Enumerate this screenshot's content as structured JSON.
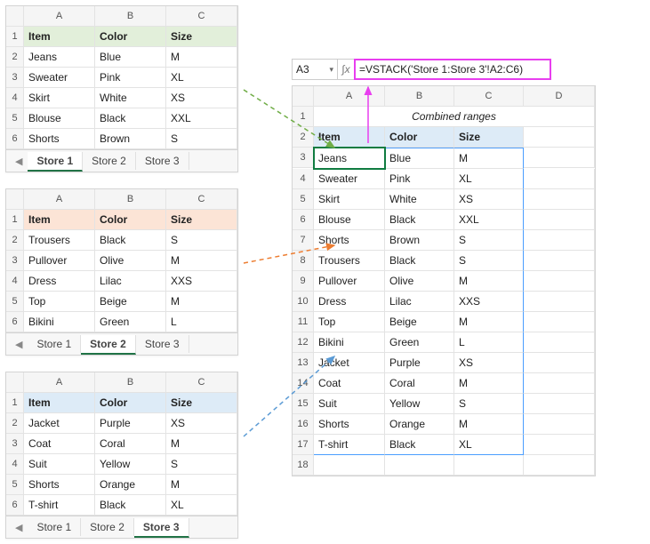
{
  "columns": [
    "A",
    "B",
    "C"
  ],
  "header_labels": {
    "item": "Item",
    "color": "Color",
    "size": "Size"
  },
  "store1": {
    "tab": "Store 1",
    "rows": [
      {
        "item": "Jeans",
        "color": "Blue",
        "size": "M"
      },
      {
        "item": "Sweater",
        "color": "Pink",
        "size": "XL"
      },
      {
        "item": "Skirt",
        "color": "White",
        "size": "XS"
      },
      {
        "item": "Blouse",
        "color": "Black",
        "size": "XXL"
      },
      {
        "item": "Shorts",
        "color": "Brown",
        "size": "S"
      }
    ]
  },
  "store2": {
    "tab": "Store 2",
    "rows": [
      {
        "item": "Trousers",
        "color": "Black",
        "size": "S"
      },
      {
        "item": "Pullover",
        "color": "Olive",
        "size": "M"
      },
      {
        "item": "Dress",
        "color": "Lilac",
        "size": "XXS"
      },
      {
        "item": "Top",
        "color": "Beige",
        "size": "M"
      },
      {
        "item": "Bikini",
        "color": "Green",
        "size": "L"
      }
    ]
  },
  "store3": {
    "tab": "Store 3",
    "rows": [
      {
        "item": "Jacket",
        "color": "Purple",
        "size": "XS"
      },
      {
        "item": "Coat",
        "color": "Coral",
        "size": "M"
      },
      {
        "item": "Suit",
        "color": "Yellow",
        "size": "S"
      },
      {
        "item": "Shorts",
        "color": "Orange",
        "size": "M"
      },
      {
        "item": "T-shirt",
        "color": "Black",
        "size": "XL"
      }
    ]
  },
  "result": {
    "namebox": "A3",
    "formula": "=VSTACK('Store 1:Store 3'!A2:C6)",
    "title": "Combined ranges",
    "columns": [
      "A",
      "B",
      "C",
      "D"
    ],
    "header_labels": {
      "item": "Item",
      "color": "Color",
      "size": "Size"
    },
    "rows": [
      {
        "item": "Jeans",
        "color": "Blue",
        "size": "M"
      },
      {
        "item": "Sweater",
        "color": "Pink",
        "size": "XL"
      },
      {
        "item": "Skirt",
        "color": "White",
        "size": "XS"
      },
      {
        "item": "Blouse",
        "color": "Black",
        "size": "XXL"
      },
      {
        "item": "Shorts",
        "color": "Brown",
        "size": "S"
      },
      {
        "item": "Trousers",
        "color": "Black",
        "size": "S"
      },
      {
        "item": "Pullover",
        "color": "Olive",
        "size": "M"
      },
      {
        "item": "Dress",
        "color": "Lilac",
        "size": "XXS"
      },
      {
        "item": "Top",
        "color": "Beige",
        "size": "M"
      },
      {
        "item": "Bikini",
        "color": "Green",
        "size": "L"
      },
      {
        "item": "Jacket",
        "color": "Purple",
        "size": "XS"
      },
      {
        "item": "Coat",
        "color": "Coral",
        "size": "M"
      },
      {
        "item": "Suit",
        "color": "Yellow",
        "size": "S"
      },
      {
        "item": "Shorts",
        "color": "Orange",
        "size": "M"
      },
      {
        "item": "T-shirt",
        "color": "Black",
        "size": "XL"
      }
    ]
  },
  "tabs_all": [
    "Store 1",
    "Store 2",
    "Store 3"
  ]
}
